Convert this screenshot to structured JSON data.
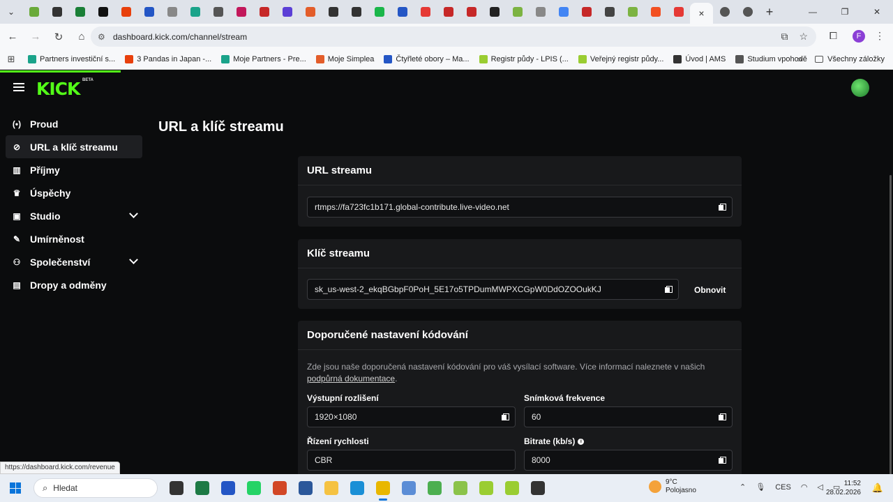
{
  "browser": {
    "tab_colors": [
      "#6aaa3a",
      "#333333",
      "#1a7f37",
      "#111111",
      "#e8400c",
      "#2456c5",
      "#888888",
      "#1aa38a",
      "#555555",
      "#c2185b",
      "#c62828",
      "#5b3fd6",
      "#e35d2a",
      "#333333",
      "#333333",
      "#1ab64a",
      "#2456c5",
      "#e53935",
      "#c62828",
      "#c62828",
      "#222222",
      "#7cb342",
      "#888888",
      "#4285f4",
      "#c62828",
      "#444444",
      "#7cb342",
      "#f25022",
      "#e53935"
    ],
    "active_tab_close": "×",
    "url": "dashboard.kick.com/channel/stream",
    "profile_initial": "F",
    "bookmarks": [
      {
        "label": "Partners investiční s...",
        "color": "#1aa38a"
      },
      {
        "label": "3 Pandas in Japan -...",
        "color": "#e8400c"
      },
      {
        "label": "Moje Partners - Pre...",
        "color": "#1aa38a"
      },
      {
        "label": "Moje Simplea",
        "color": "#e35d2a"
      },
      {
        "label": "Čtyřleté obory – Ma...",
        "color": "#2456c5"
      },
      {
        "label": "Registr půdy - LPIS (...",
        "color": "#9acd32"
      },
      {
        "label": "Veřejný registr půdy...",
        "color": "#9acd32"
      },
      {
        "label": "Úvod | AMS",
        "color": "#333333"
      },
      {
        "label": "Studium vpohodě",
        "color": "#555555"
      }
    ],
    "all_bookmarks": "Všechny záložky",
    "status_url": "https://dashboard.kick.com/revenue"
  },
  "app": {
    "logo": "KICK",
    "beta": "BETA",
    "sidebar": [
      {
        "label": "Proud",
        "icon": "stream-icon",
        "glyph": "(•)",
        "active": false,
        "expandable": false
      },
      {
        "label": "URL a klíč streamu",
        "icon": "link-icon",
        "glyph": "⊘",
        "active": true,
        "expandable": false
      },
      {
        "label": "Příjmy",
        "icon": "bar-chart-icon",
        "glyph": "▥",
        "active": false,
        "expandable": false
      },
      {
        "label": "Úspěchy",
        "icon": "trophy-icon",
        "glyph": "♛",
        "active": false,
        "expandable": false
      },
      {
        "label": "Studio",
        "icon": "studio-icon",
        "glyph": "▣",
        "active": false,
        "expandable": true
      },
      {
        "label": "Umírněnost",
        "icon": "wrench-icon",
        "glyph": "✎",
        "active": false,
        "expandable": false
      },
      {
        "label": "Společenství",
        "icon": "community-icon",
        "glyph": "⚇",
        "active": false,
        "expandable": true
      },
      {
        "label": "Dropy a odměny",
        "icon": "gift-icon",
        "glyph": "▤",
        "active": false,
        "expandable": false
      }
    ],
    "page_title": "URL a klíč streamu",
    "stream_url_card": {
      "title": "URL streamu",
      "value": "rtmps://fa723fc1b171.global-contribute.live-video.net"
    },
    "stream_key_card": {
      "title": "Klíč streamu",
      "value": "sk_us-west-2_ekqBGbpF0PoH_5E17o5TPDumMWPXCGpW0DdOZOOukKJ",
      "refresh_label": "Obnovit"
    },
    "encoding_card": {
      "title": "Doporučené nastavení kódování",
      "description": "Zde jsou naše doporučená nastavení kódování pro váš vysílací software. Více informací naleznete v našich ",
      "link": "podpůrná dokumentace",
      "after_link": ".",
      "resolution_label": "Výstupní rozlišení",
      "resolution_value": "1920×1080",
      "framerate_label": "Snímková frekvence",
      "framerate_value": "60",
      "rate_control_label": "Řízení rychlosti",
      "rate_control_value": "CBR",
      "bitrate_label": "Bitrate (kb/s)",
      "bitrate_value": "8000"
    }
  },
  "taskbar": {
    "search_placeholder": "Hledat",
    "apps": [
      {
        "name": "file-explorer",
        "color": "#333333"
      },
      {
        "name": "excel",
        "color": "#1d7a45"
      },
      {
        "name": "store",
        "color": "#2456c5"
      },
      {
        "name": "whatsapp",
        "color": "#25d366"
      },
      {
        "name": "powerpoint",
        "color": "#d24726"
      },
      {
        "name": "word",
        "color": "#2b579a"
      },
      {
        "name": "folder",
        "color": "#f5c242"
      },
      {
        "name": "edge",
        "color": "#1a8fd6"
      },
      {
        "name": "chrome",
        "color": "#e8b700"
      },
      {
        "name": "photos",
        "color": "#5b8dd6"
      },
      {
        "name": "szif",
        "color": "#4caf50"
      },
      {
        "name": "app-leaf-1",
        "color": "#8bc34a"
      },
      {
        "name": "app-leaf-2",
        "color": "#9acd32"
      },
      {
        "name": "app-leaf-3",
        "color": "#9acd32"
      },
      {
        "name": "chatgpt",
        "color": "#333333"
      }
    ],
    "active_app": "chrome",
    "weather_temp": "9°C",
    "weather_text": "Polojasno",
    "weather_badge": "3",
    "language": "CES",
    "time": "11:52",
    "date": "28.02.2026"
  }
}
